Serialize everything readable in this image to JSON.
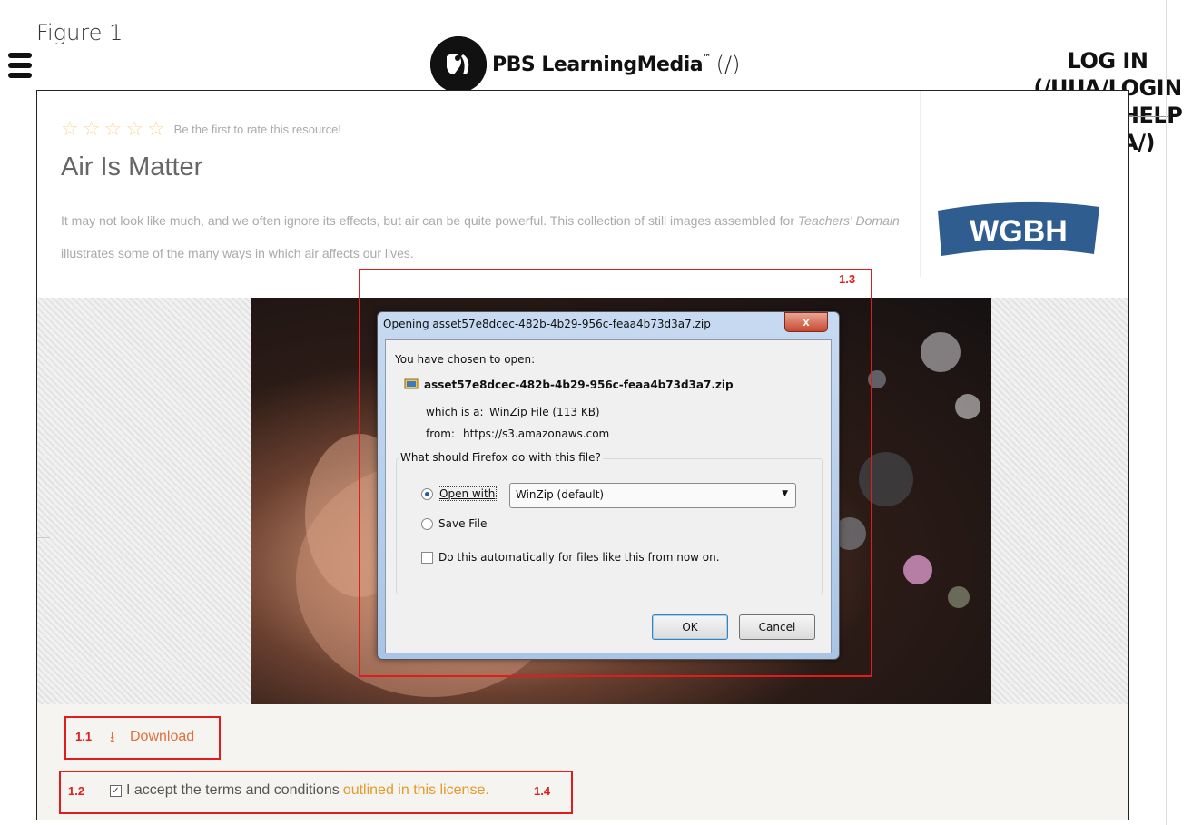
{
  "figure_label": "Figure 1",
  "site": {
    "logo_text": "PBS LearningMedia",
    "logo_tm": "™",
    "logo_path": "(/)",
    "login_lines": [
      "LOG IN",
      "(/UUA/LOGIN",
      "NEXT=/HELP",
      "MEDIA/)"
    ]
  },
  "resource": {
    "rating_text": "Be the first to rate this resource!",
    "title": "Air Is Matter",
    "description_part1": "It may not look like much, and we often ignore its effects, but air can be quite powerful. This collection of still images assembled for ",
    "description_italic": "Teachers' Domain",
    "description_part2": " illustrates some of the many ways in which air affects our lives.",
    "producer_logo": "WGBH"
  },
  "dialog": {
    "title": "Opening asset57e8dcec-482b-4b29-956c-feaa4b73d3a7.zip",
    "close_label": "x",
    "chosen_label": "You have chosen to open:",
    "file_name": "asset57e8dcec-482b-4b29-956c-feaa4b73d3a7.zip",
    "which_is_label": "which is a:",
    "which_is_value": "WinZip File (113 KB)",
    "from_label": "from:",
    "from_value": "https://s3.amazonaws.com",
    "question": "What should Firefox do with this file?",
    "open_with_label": "Open with",
    "open_with_selected": true,
    "open_with_app": "WinZip (default)",
    "save_file_label": "Save File",
    "auto_label": "Do this automatically for files like this from now on.",
    "ok_label": "OK",
    "cancel_label": "Cancel"
  },
  "actions": {
    "download_label": "Download",
    "terms_text": "I accept the terms and conditions",
    "terms_link": "outlined in this license.",
    "terms_checked": true
  },
  "callouts": {
    "c11": "1.1",
    "c12": "1.2",
    "c13": "1.3",
    "c14": "1.4"
  },
  "colors": {
    "callout": "#e01c1c",
    "link": "#e0703a",
    "terms_link": "#e49a2a"
  }
}
